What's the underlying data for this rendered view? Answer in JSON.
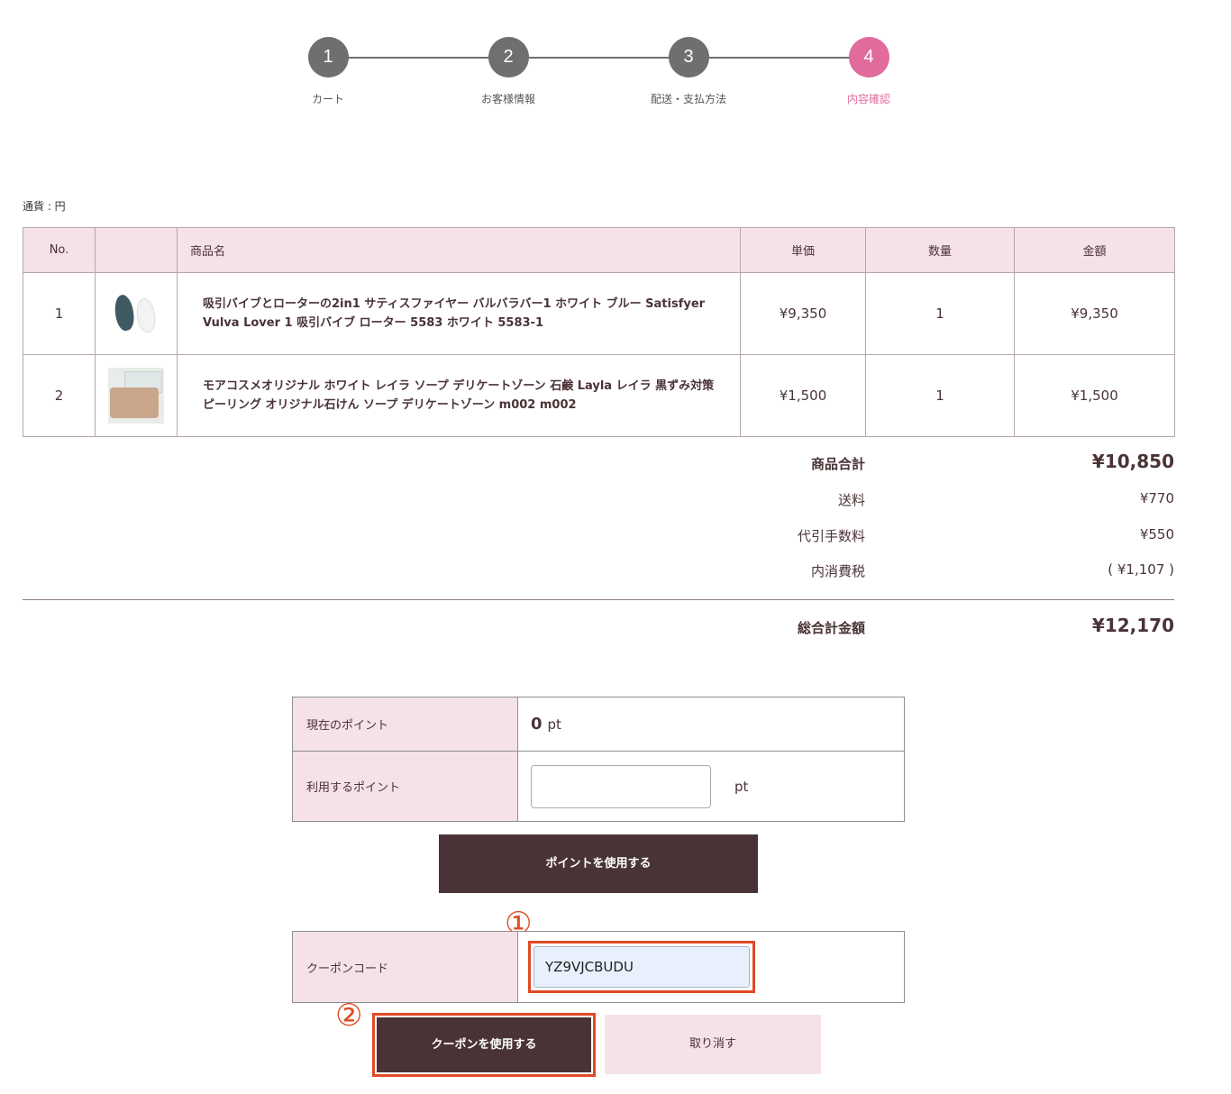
{
  "steps": [
    {
      "num": "1",
      "label": "カート"
    },
    {
      "num": "2",
      "label": "お客様情報"
    },
    {
      "num": "3",
      "label": "配送・支払方法"
    },
    {
      "num": "4",
      "label": "内容確認"
    }
  ],
  "currency_label": "通貨 : 円",
  "cart": {
    "headers": {
      "no": "No.",
      "name": "商品名",
      "unit_price": "単価",
      "qty": "数量",
      "amount": "金額"
    },
    "rows": [
      {
        "no": "1",
        "name": "吸引バイブとローターの2in1 サティスファイヤー バルバラバー1 ホワイト ブルー Satisfyer Vulva Lover 1 吸引バイブ ローター 5583 ホワイト 5583-1",
        "unit_price": "¥9,350",
        "qty": "1",
        "amount": "¥9,350"
      },
      {
        "no": "2",
        "name": "モアコスメオリジナル ホワイト レイラ ソープ デリケートゾーン 石鹸 Layla レイラ 黒ずみ対策 ピーリング オリジナル石けん ソープ デリケートゾーン m002 m002",
        "unit_price": "¥1,500",
        "qty": "1",
        "amount": "¥1,500"
      }
    ]
  },
  "totals": {
    "subtotal_label": "商品合計",
    "subtotal": "¥10,850",
    "shipping_label": "送料",
    "shipping": "¥770",
    "cod_label": "代引手数料",
    "cod": "¥550",
    "tax_label": "内消費税",
    "tax": "( ¥1,107 )",
    "grand_label": "総合計金額",
    "grand": "¥12,170"
  },
  "points": {
    "current_label": "現在のポイント",
    "current_value": "0",
    "unit": "pt",
    "use_label": "利用するポイント",
    "use_value": "",
    "use_button": "ポイントを使用する"
  },
  "coupon": {
    "label": "クーポンコード",
    "value": "YZ9VJCBUDU",
    "use_button": "クーポンを使用する",
    "cancel_button": "取り消す"
  },
  "annotations": {
    "marker1": "①",
    "marker2": "②"
  },
  "colors": {
    "accent_pink": "#e16b9c",
    "dark_button": "#4a3336",
    "header_bg": "#f5e1e8",
    "highlight": "#e04a25"
  }
}
